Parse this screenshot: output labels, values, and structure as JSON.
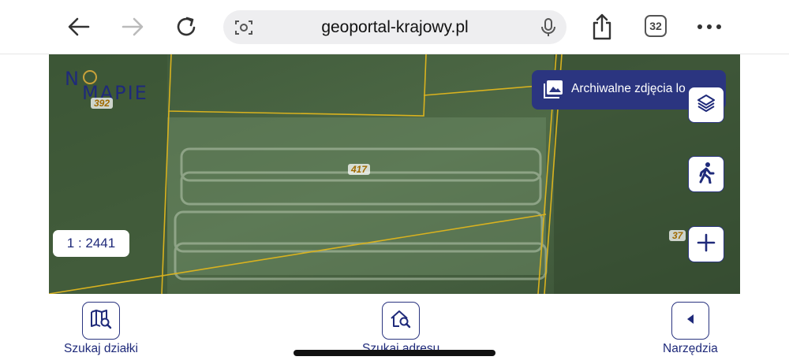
{
  "browser": {
    "url": "geoportal-krajowy.pl",
    "tab_count": "32"
  },
  "map": {
    "logo_part1": "N",
    "logo_part2": "MAPIE",
    "parcels": [
      "392",
      "417",
      "37"
    ],
    "archive_button_label": "Archiwalne zdjęcia lo",
    "scale": "1 : 2441"
  },
  "toolbar": {
    "search_parcel_label": "Szukaj działki",
    "search_address_label": "Szukaj adresu",
    "tools_label": "Narzędzia"
  },
  "colors": {
    "accent": "#2b3580",
    "parcel_boundary": "#d9b21f"
  }
}
